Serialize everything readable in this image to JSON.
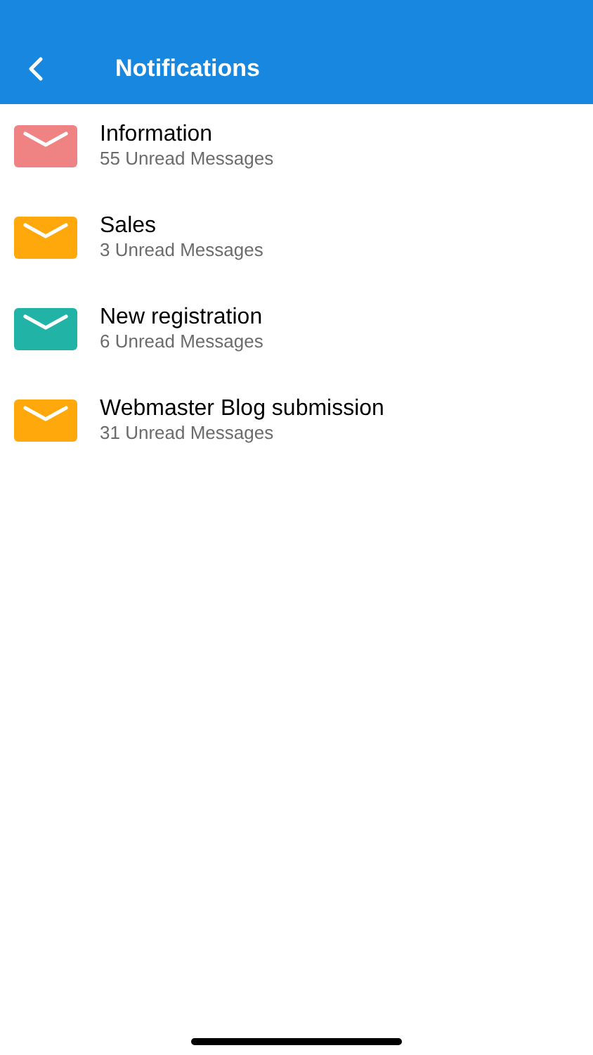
{
  "header": {
    "title": "Notifications"
  },
  "notifications": [
    {
      "title": "Information",
      "subtitle": "55 Unread Messages",
      "color": "#ef8283"
    },
    {
      "title": "Sales",
      "subtitle": "3 Unread Messages",
      "color": "#ffa80c"
    },
    {
      "title": "New registration",
      "subtitle": "6 Unread Messages",
      "color": "#20b3a6"
    },
    {
      "title": "Webmaster Blog submission",
      "subtitle": "31 Unread Messages",
      "color": "#ffa80c"
    }
  ]
}
